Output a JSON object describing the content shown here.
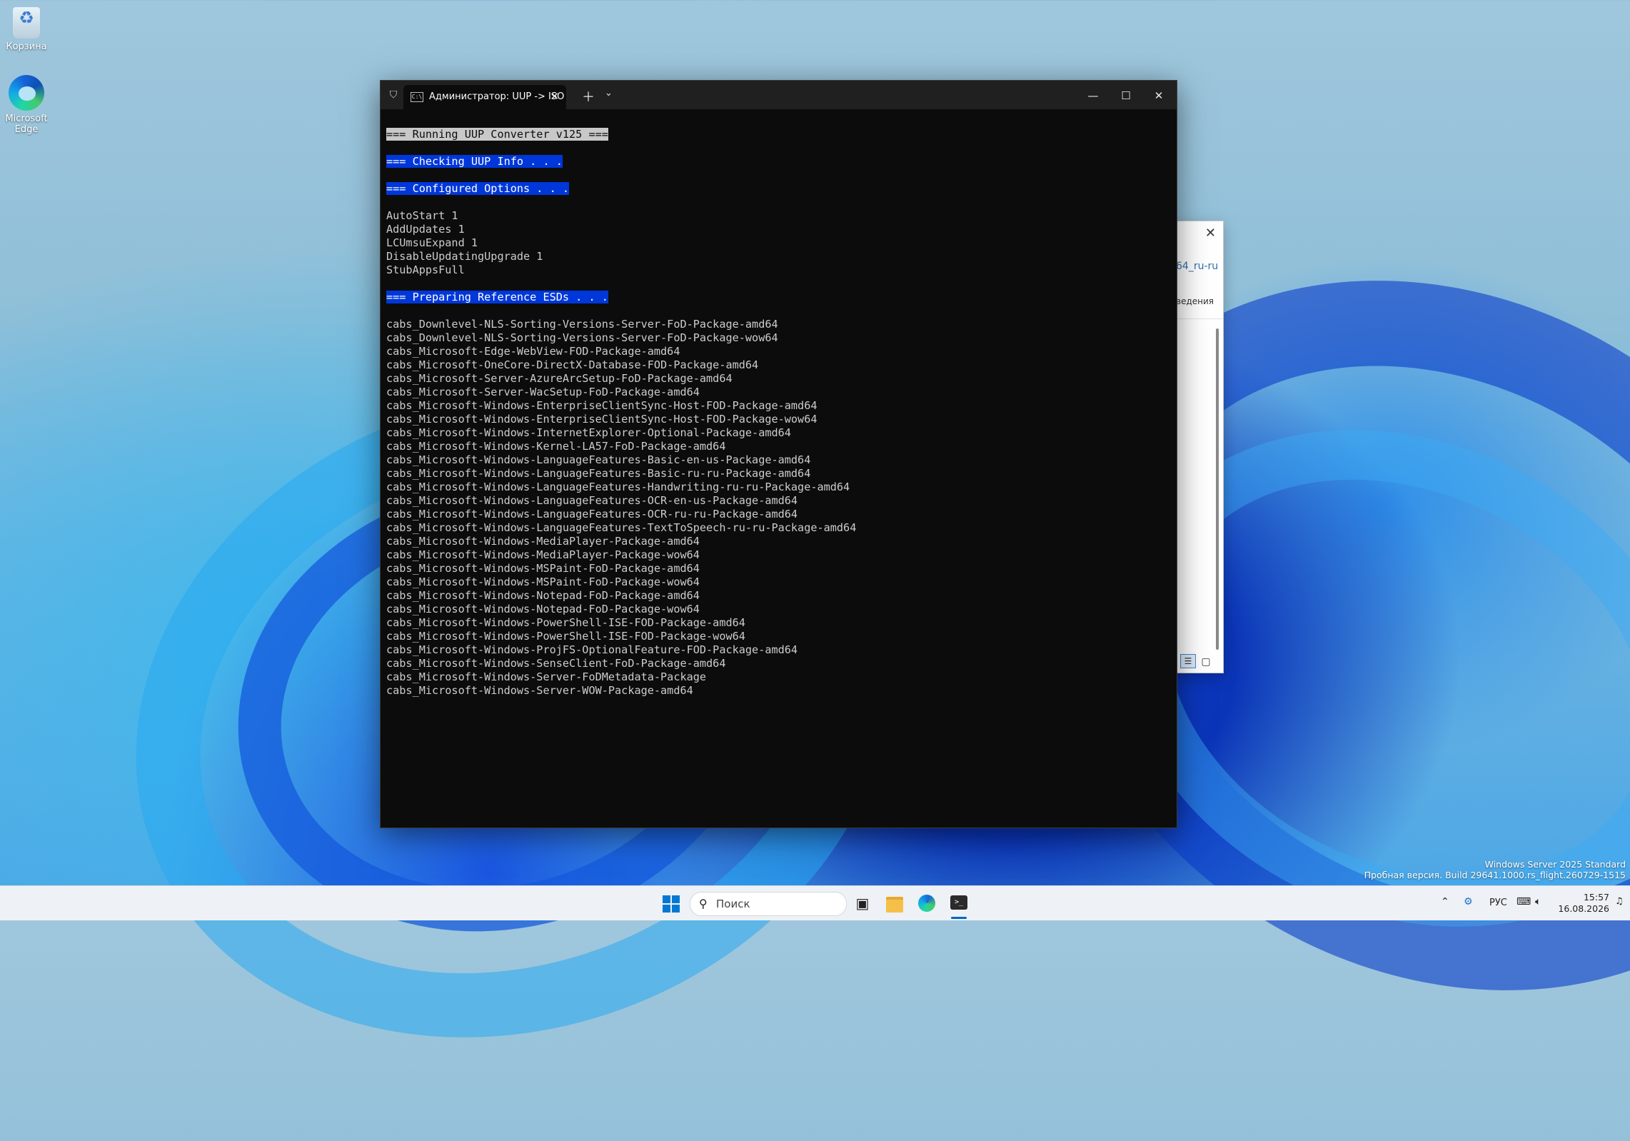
{
  "desktop": {
    "icons": [
      {
        "label": "Корзина"
      },
      {
        "label": "Microsoft Edge"
      }
    ]
  },
  "background_window": {
    "path_fragment": "64_ru-ru",
    "text_fragment": "ведения"
  },
  "terminal": {
    "tab_title": "Администратор:  UUP -> ISO",
    "lines": [
      {
        "text": "=== Running UUP Converter v125 ===",
        "style": "hl-gray"
      },
      {
        "text": "",
        "style": ""
      },
      {
        "text": "=== Checking UUP Info . . .",
        "style": "hl-blue"
      },
      {
        "text": "",
        "style": ""
      },
      {
        "text": "=== Configured Options . . .",
        "style": "hl-blue"
      },
      {
        "text": "",
        "style": ""
      },
      {
        "text": "AutoStart 1",
        "style": ""
      },
      {
        "text": "AddUpdates 1",
        "style": ""
      },
      {
        "text": "LCUmsuExpand 1",
        "style": ""
      },
      {
        "text": "DisableUpdatingUpgrade 1",
        "style": ""
      },
      {
        "text": "StubAppsFull",
        "style": ""
      },
      {
        "text": "",
        "style": ""
      },
      {
        "text": "=== Preparing Reference ESDs . . .",
        "style": "hl-blue"
      },
      {
        "text": "",
        "style": ""
      },
      {
        "text": "cabs_Downlevel-NLS-Sorting-Versions-Server-FoD-Package-amd64",
        "style": ""
      },
      {
        "text": "cabs_Downlevel-NLS-Sorting-Versions-Server-FoD-Package-wow64",
        "style": ""
      },
      {
        "text": "cabs_Microsoft-Edge-WebView-FOD-Package-amd64",
        "style": ""
      },
      {
        "text": "cabs_Microsoft-OneCore-DirectX-Database-FOD-Package-amd64",
        "style": ""
      },
      {
        "text": "cabs_Microsoft-Server-AzureArcSetup-FoD-Package-amd64",
        "style": ""
      },
      {
        "text": "cabs_Microsoft-Server-WacSetup-FoD-Package-amd64",
        "style": ""
      },
      {
        "text": "cabs_Microsoft-Windows-EnterpriseClientSync-Host-FOD-Package-amd64",
        "style": ""
      },
      {
        "text": "cabs_Microsoft-Windows-EnterpriseClientSync-Host-FOD-Package-wow64",
        "style": ""
      },
      {
        "text": "cabs_Microsoft-Windows-InternetExplorer-Optional-Package-amd64",
        "style": ""
      },
      {
        "text": "cabs_Microsoft-Windows-Kernel-LA57-FoD-Package-amd64",
        "style": ""
      },
      {
        "text": "cabs_Microsoft-Windows-LanguageFeatures-Basic-en-us-Package-amd64",
        "style": ""
      },
      {
        "text": "cabs_Microsoft-Windows-LanguageFeatures-Basic-ru-ru-Package-amd64",
        "style": ""
      },
      {
        "text": "cabs_Microsoft-Windows-LanguageFeatures-Handwriting-ru-ru-Package-amd64",
        "style": ""
      },
      {
        "text": "cabs_Microsoft-Windows-LanguageFeatures-OCR-en-us-Package-amd64",
        "style": ""
      },
      {
        "text": "cabs_Microsoft-Windows-LanguageFeatures-OCR-ru-ru-Package-amd64",
        "style": ""
      },
      {
        "text": "cabs_Microsoft-Windows-LanguageFeatures-TextToSpeech-ru-ru-Package-amd64",
        "style": ""
      },
      {
        "text": "cabs_Microsoft-Windows-MediaPlayer-Package-amd64",
        "style": ""
      },
      {
        "text": "cabs_Microsoft-Windows-MediaPlayer-Package-wow64",
        "style": ""
      },
      {
        "text": "cabs_Microsoft-Windows-MSPaint-FoD-Package-amd64",
        "style": ""
      },
      {
        "text": "cabs_Microsoft-Windows-MSPaint-FoD-Package-wow64",
        "style": ""
      },
      {
        "text": "cabs_Microsoft-Windows-Notepad-FoD-Package-amd64",
        "style": ""
      },
      {
        "text": "cabs_Microsoft-Windows-Notepad-FoD-Package-wow64",
        "style": ""
      },
      {
        "text": "cabs_Microsoft-Windows-PowerShell-ISE-FOD-Package-amd64",
        "style": ""
      },
      {
        "text": "cabs_Microsoft-Windows-PowerShell-ISE-FOD-Package-wow64",
        "style": ""
      },
      {
        "text": "cabs_Microsoft-Windows-ProjFS-OptionalFeature-FOD-Package-amd64",
        "style": ""
      },
      {
        "text": "cabs_Microsoft-Windows-SenseClient-FoD-Package-amd64",
        "style": ""
      },
      {
        "text": "cabs_Microsoft-Windows-Server-FoDMetadata-Package",
        "style": ""
      },
      {
        "text": "cabs_Microsoft-Windows-Server-WOW-Package-amd64",
        "style": ""
      }
    ]
  },
  "watermark": {
    "line1": "Windows Server 2025 Standard",
    "line2": "Пробная версия. Build 29641.1000.rs_flight.260729-1515"
  },
  "taskbar": {
    "search_placeholder": "Поиск",
    "language": "РУС",
    "time": "15:57",
    "date": "16.08.2026"
  },
  "colors": {
    "terminal_bg": "#0c0c0c",
    "highlight_blue": "#0037da",
    "highlight_gray": "#c8c8c8",
    "accent": "#0078d4"
  }
}
